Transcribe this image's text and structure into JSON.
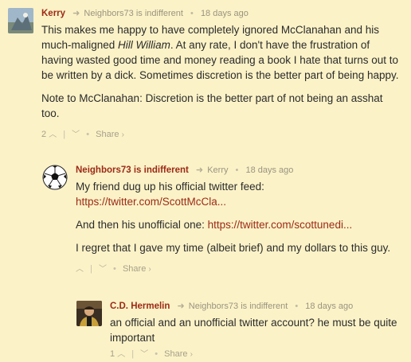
{
  "comments": [
    {
      "author": "Kerry",
      "reply_to": "Neighbors73 is indifferent",
      "time": "18 days ago",
      "paragraphs": {
        "p1_before": "This makes me happy to have completely ignored McClanahan and his much-maligned ",
        "p1_em": "Hill William",
        "p1_after": ". At any rate, I don't have the frustration of having wasted good time and money reading a book I hate that turns out to be written by a dick. Sometimes discretion is the better part of being happy.",
        "p2": "Note to McClanahan: Discretion is the better part of not being an asshat too."
      },
      "votes": "2",
      "share": "Share"
    },
    {
      "author": "Neighbors73 is indifferent",
      "reply_to": "Kerry",
      "time": "18 days ago",
      "p1": "My friend dug up his official twitter feed:",
      "link1": "https://twitter.com/ScottMcCla...",
      "p2_before": "And then his unofficial one: ",
      "link2": "https://twitter.com/scottunedi...",
      "p3": "I regret that I gave my time (albeit brief) and my dollars to this guy.",
      "votes": "",
      "share": "Share"
    },
    {
      "author": "C.D. Hermelin",
      "reply_to": "Neighbors73 is indifferent",
      "time": "18 days ago",
      "p1": "an official and an unofficial twitter account? he must be quite important",
      "votes": "1",
      "share": "Share"
    }
  ],
  "icons": {
    "reply": "reply-arrow-icon",
    "upvote": "chevron-up-icon",
    "downvote": "chevron-down-icon",
    "share_more": "chevron-right-icon"
  }
}
